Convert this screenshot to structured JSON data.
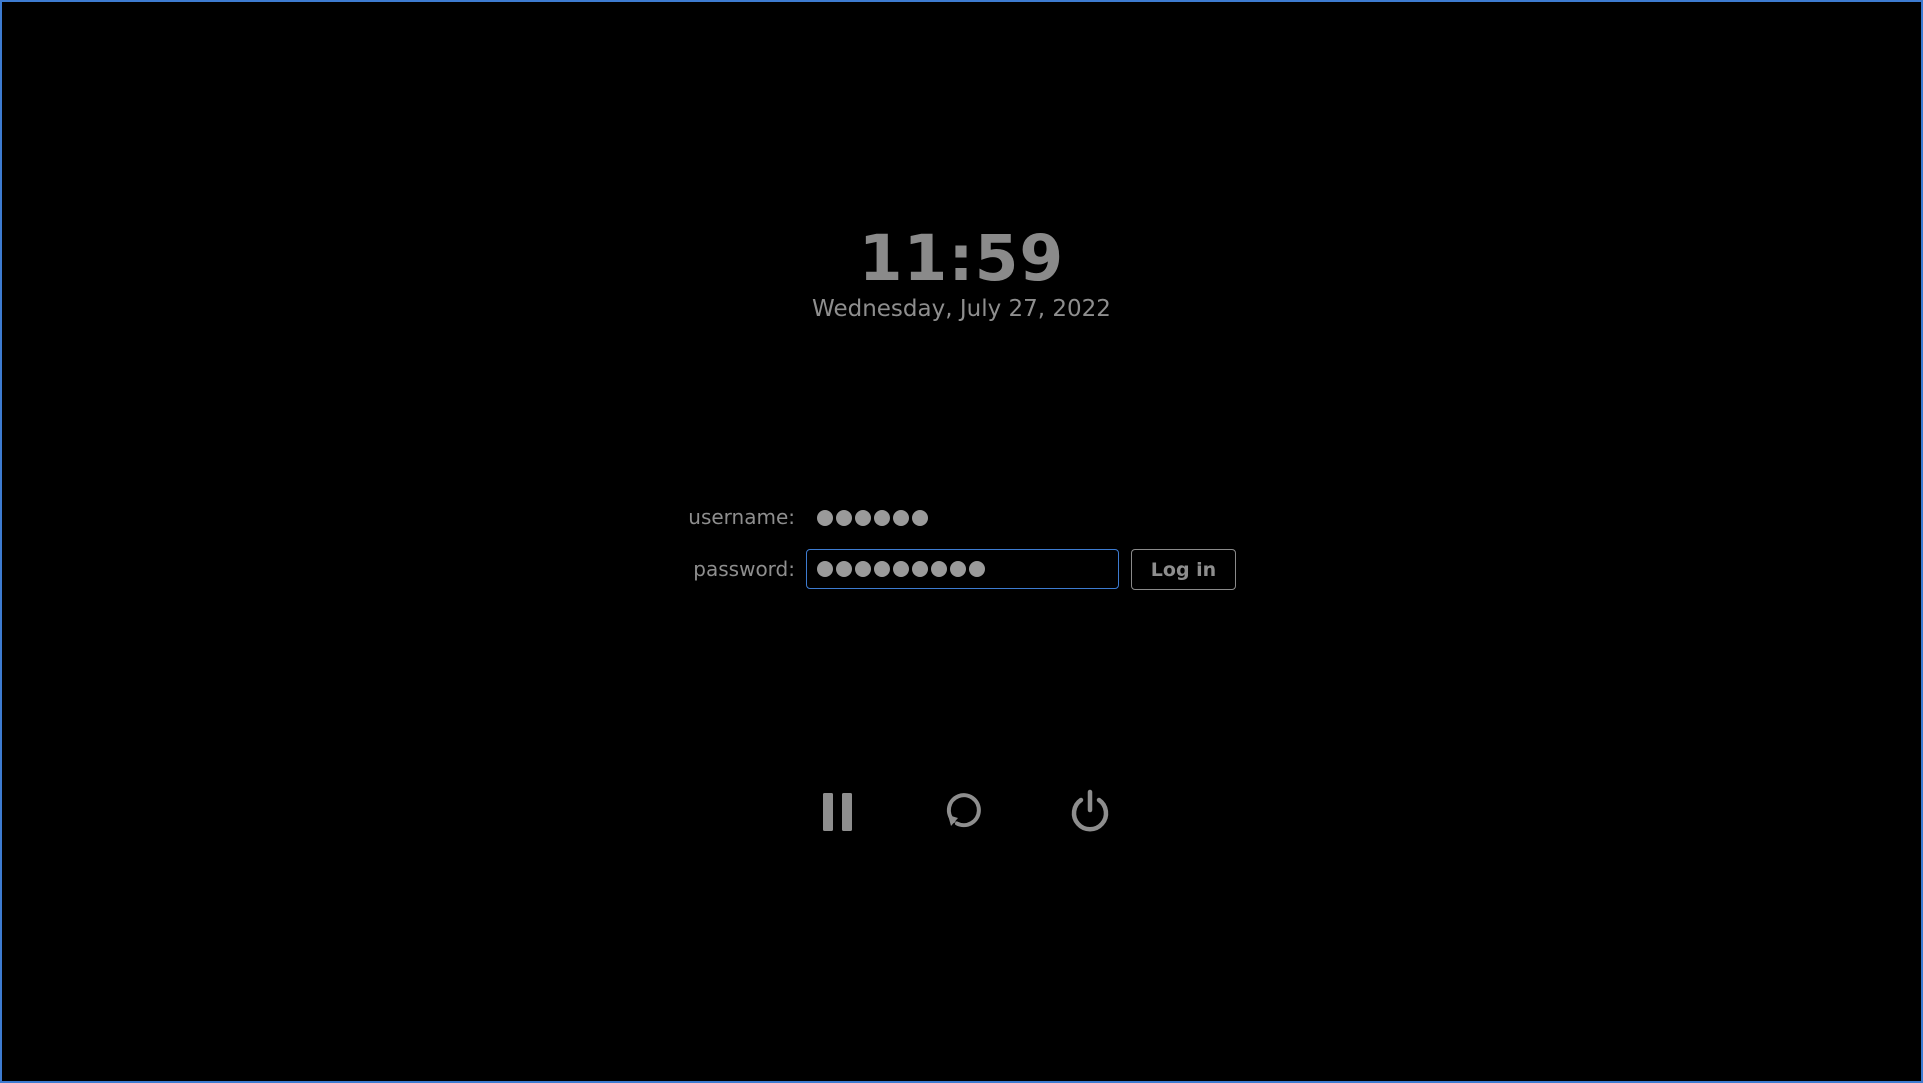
{
  "clock": {
    "time": "11:59",
    "date": "Wednesday, July 27, 2022"
  },
  "login": {
    "username_label": "username:",
    "password_label": "password:",
    "username_masked_count": 6,
    "password_masked_count": 9,
    "login_button_label": "Log in"
  },
  "power_actions": [
    {
      "name": "suspend",
      "icon": "pause-icon"
    },
    {
      "name": "restart",
      "icon": "restart-icon"
    },
    {
      "name": "shutdown",
      "icon": "power-icon"
    }
  ],
  "colors": {
    "background": "#000000",
    "text": "#8e8e8e",
    "focus_accent": "#3d7bd0"
  }
}
